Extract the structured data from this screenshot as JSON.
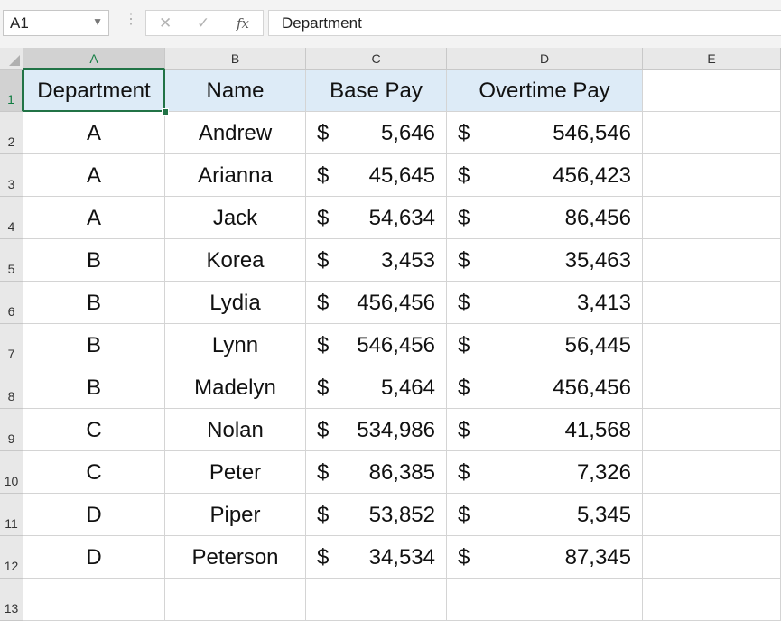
{
  "name_box": {
    "value": "A1"
  },
  "formula_bar": {
    "value": "Department"
  },
  "icons": {
    "name_box_dropdown": "chevron-down-icon",
    "cancel": "close-icon",
    "enter": "check-icon",
    "insert_function": "function-icon"
  },
  "columns": [
    "A",
    "B",
    "C",
    "D",
    "E"
  ],
  "rows": [
    "1",
    "2",
    "3",
    "4",
    "5",
    "6",
    "7",
    "8",
    "9",
    "10",
    "11",
    "12",
    "13"
  ],
  "table": {
    "headers": [
      "Department",
      "Name",
      "Base Pay",
      "Overtime Pay"
    ],
    "currency_symbol": "$",
    "rows": [
      {
        "department": "A",
        "name": "Andrew",
        "base_pay": "5,646",
        "overtime_pay": "546,546"
      },
      {
        "department": "A",
        "name": "Arianna",
        "base_pay": "45,645",
        "overtime_pay": "456,423"
      },
      {
        "department": "A",
        "name": "Jack",
        "base_pay": "54,634",
        "overtime_pay": "86,456"
      },
      {
        "department": "B",
        "name": "Korea",
        "base_pay": "3,453",
        "overtime_pay": "35,463"
      },
      {
        "department": "B",
        "name": "Lydia",
        "base_pay": "456,456",
        "overtime_pay": "3,413"
      },
      {
        "department": "B",
        "name": "Lynn",
        "base_pay": "546,456",
        "overtime_pay": "56,445"
      },
      {
        "department": "B",
        "name": "Madelyn",
        "base_pay": "5,464",
        "overtime_pay": "456,456"
      },
      {
        "department": "C",
        "name": "Nolan",
        "base_pay": "534,986",
        "overtime_pay": "41,568"
      },
      {
        "department": "C",
        "name": "Peter",
        "base_pay": "86,385",
        "overtime_pay": "7,326"
      },
      {
        "department": "D",
        "name": "Piper",
        "base_pay": "53,852",
        "overtime_pay": "5,345"
      },
      {
        "department": "D",
        "name": "Peterson",
        "base_pay": "34,534",
        "overtime_pay": "87,345"
      }
    ]
  },
  "colors": {
    "header_fill": "#ddebf7",
    "selection_accent": "#217346"
  }
}
